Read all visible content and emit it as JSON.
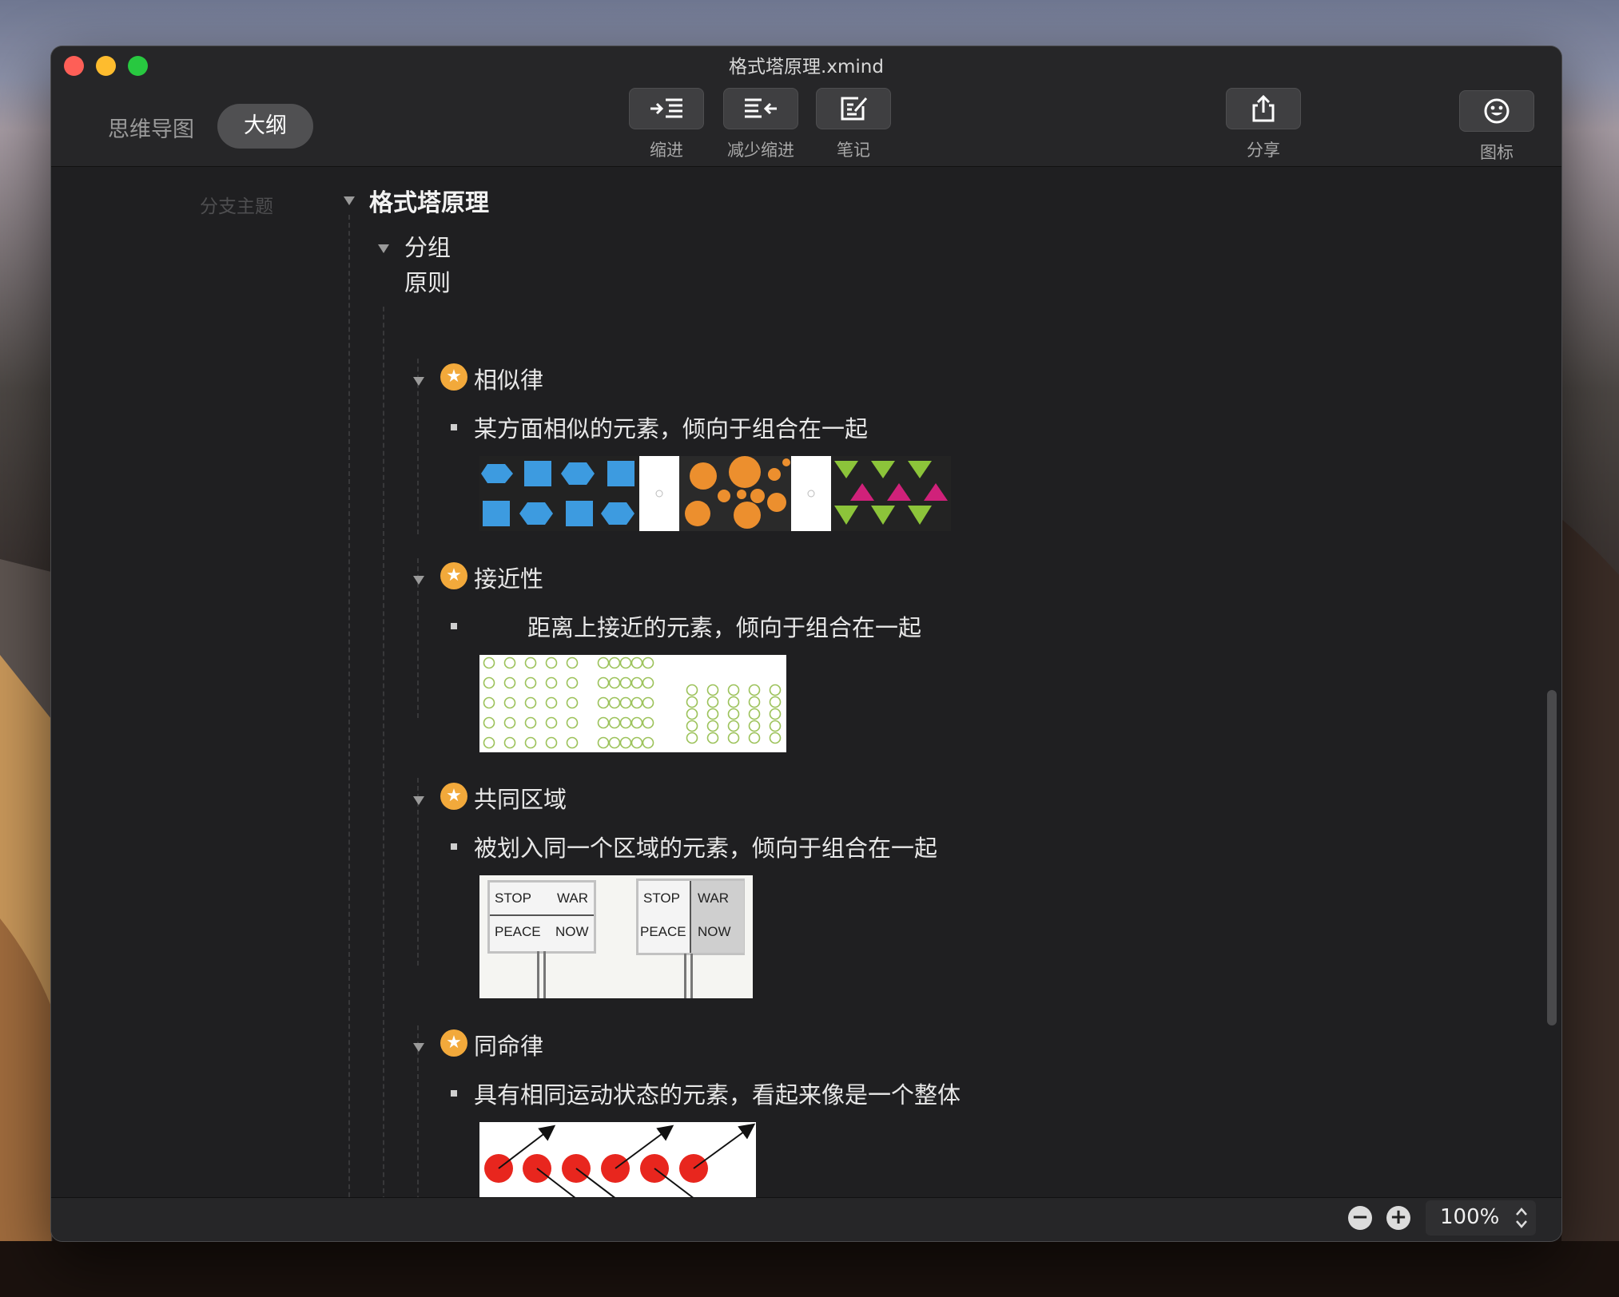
{
  "window": {
    "title": "格式塔原理.xmind"
  },
  "view_switch": {
    "mindmap": "思维导图",
    "outline": "大纲"
  },
  "toolbar": {
    "indent": "缩进",
    "outdent": "减少缩进",
    "notes": "笔记",
    "share": "分享",
    "icons": "图标"
  },
  "sidebar": {
    "label": "分支主题"
  },
  "outline": {
    "root": "格式塔原理",
    "group": {
      "line1": "分组",
      "line2": "原则"
    },
    "items": [
      {
        "title": "相似律",
        "note": "某方面相似的元素，倾向于组合在一起"
      },
      {
        "title": "接近性",
        "note": "距离上接近的元素，倾向于组合在一起"
      },
      {
        "title": "共同区域",
        "note": "被划入同一个区域的元素，倾向于组合在一起"
      },
      {
        "title": "同命律",
        "note": "具有相同运动状态的元素，看起来像是一个整体"
      }
    ]
  },
  "signs": {
    "stop": "STOP",
    "war": "WAR",
    "peace": "PEACE",
    "now": "NOW"
  },
  "status": {
    "zoom": "100%"
  },
  "colors": {
    "star": "#f2a93b",
    "hex_blue": "#3d9be0",
    "dot_orange": "#ec8f2e",
    "tri_green": "#8cc43a",
    "tri_magenta": "#d0217a",
    "circle_green": "#9cc25a",
    "ball_red": "#e8261e"
  }
}
